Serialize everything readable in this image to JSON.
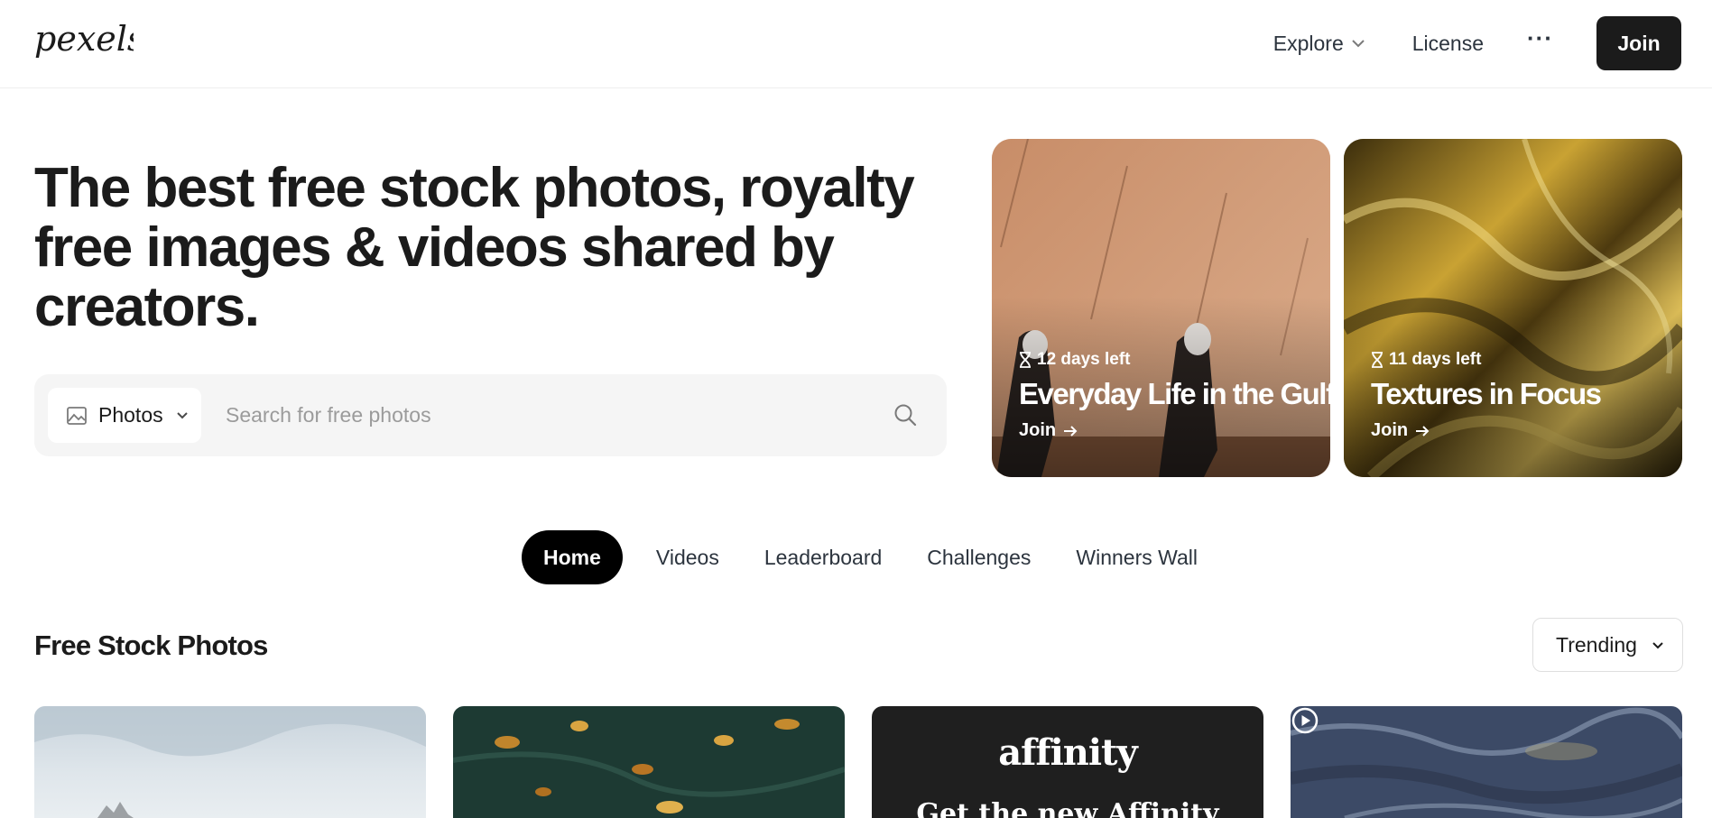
{
  "header": {
    "logo_text": "pexels",
    "nav": {
      "explore": "Explore",
      "license": "License",
      "more": "···",
      "join": "Join"
    }
  },
  "hero": {
    "title": "The best free stock photos, royalty free images & videos shared by creators."
  },
  "search": {
    "type_label": "Photos",
    "placeholder": "Search for free photos",
    "value": ""
  },
  "challenges": [
    {
      "days_left": "12 days left",
      "title": "Everyday Life in the Gulf",
      "cta": "Join"
    },
    {
      "days_left": "11 days left",
      "title": "Textures in Focus",
      "cta": "Join"
    }
  ],
  "tabs": [
    {
      "label": "Home",
      "active": true
    },
    {
      "label": "Videos",
      "active": false
    },
    {
      "label": "Leaderboard",
      "active": false
    },
    {
      "label": "Challenges",
      "active": false
    },
    {
      "label": "Winners Wall",
      "active": false
    }
  ],
  "section": {
    "title": "Free Stock Photos",
    "sort": "Trending"
  },
  "ad": {
    "brand": "affinity",
    "tagline": "Get the new Affinity"
  },
  "colors": {
    "primary_dark": "#1b1b1b",
    "text": "#2c343e",
    "search_bg": "#f5f5f5"
  },
  "icons": [
    "image-icon",
    "chevron-down-icon",
    "search-icon",
    "hourglass-icon",
    "arrow-right-icon",
    "play-icon"
  ]
}
